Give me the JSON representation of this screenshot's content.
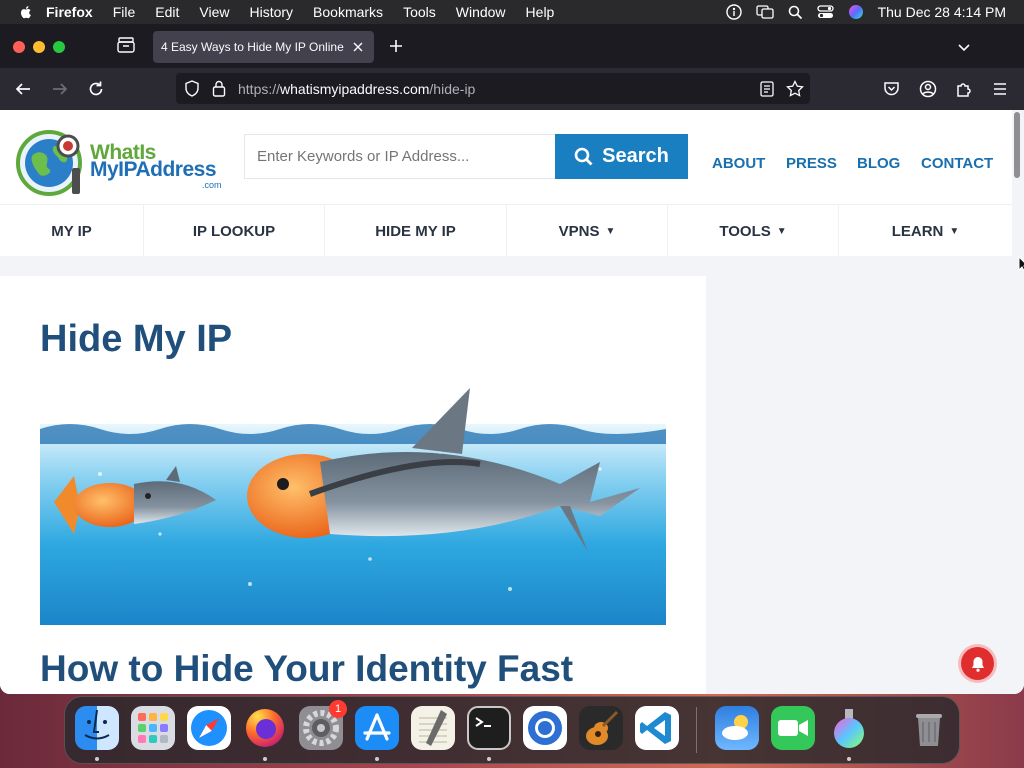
{
  "menubar": {
    "app": "Firefox",
    "items": [
      "File",
      "Edit",
      "View",
      "History",
      "Bookmarks",
      "Tools",
      "Window",
      "Help"
    ],
    "clock": "Thu Dec 28  4:14 PM"
  },
  "browser": {
    "tab_title": "4 Easy Ways to Hide My IP Online",
    "url_prefix": "https://",
    "url_host": "whatismyipaddress.com",
    "url_path": "/hide-ip"
  },
  "site": {
    "logo_line1": "WhatIs",
    "logo_line2_a": "MyIP",
    "logo_line2_b": "Address",
    "logo_suffix": ".com",
    "search_placeholder": "Enter Keywords or IP Address...",
    "search_label": "Search",
    "top_links": [
      "ABOUT",
      "PRESS",
      "BLOG",
      "CONTACT"
    ],
    "nav": [
      {
        "label": "MY IP",
        "caret": ""
      },
      {
        "label": "IP LOOKUP",
        "caret": ""
      },
      {
        "label": "HIDE MY IP",
        "caret": ""
      },
      {
        "label": "VPNS",
        "caret": "▼"
      },
      {
        "label": "TOOLS",
        "caret": "▼"
      },
      {
        "label": "LEARN",
        "caret": "▼"
      }
    ]
  },
  "article": {
    "title": "Hide My IP",
    "subtitle": "How to Hide Your Identity Fast"
  },
  "dock": {
    "apps": [
      "Finder",
      "Launchpad",
      "Safari",
      "Firefox",
      "System Settings",
      "App Store",
      "TextEdit",
      "Terminal",
      "Chromium",
      "GarageBand",
      "Visual Studio Code",
      "Weather",
      "FaceTime",
      "Disk Diag",
      "Trash"
    ],
    "settings_badge": "1"
  },
  "colors": {
    "brand_blue": "#1a7fc1",
    "heading_blue": "#1f4f7a",
    "logo_green": "#5fa83b"
  }
}
